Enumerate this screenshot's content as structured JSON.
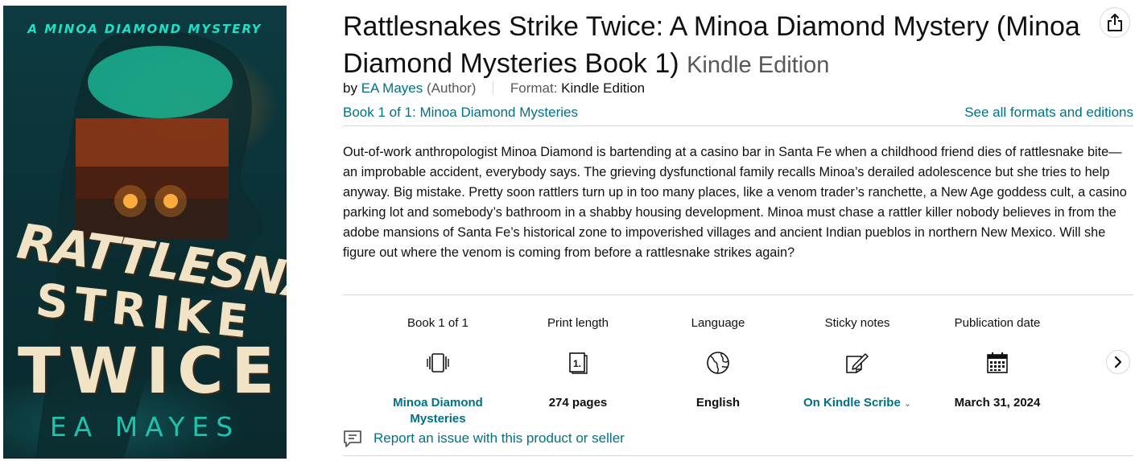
{
  "cover": {
    "series": "A MINOA DIAMOND MYSTERY",
    "title_line1": "RATTLESNAKES",
    "title_line2": "STRIKE",
    "title_line3": "TWICE",
    "author": "EA MAYES"
  },
  "product": {
    "title": "Rattlesnakes Strike Twice: A Minoa Diamond Mystery (Minoa Diamond Mysteries Book 1)",
    "edition": "Kindle Edition",
    "by": "by",
    "author": "EA Mayes",
    "author_role": "(Author)",
    "format_label": "Format:",
    "format_value": "Kindle Edition",
    "series_link": "Book 1 of 1: Minoa Diamond Mysteries",
    "formats_link": "See all formats and editions",
    "description": "Out-of-work anthropologist Minoa Diamond is bartending at a casino bar in Santa Fe when a childhood friend dies of rattlesnake bite—an improbable accident, everybody says. The grieving dysfunctional family recalls Minoa’s derailed adolescence but she tries to help anyway. Big mistake. Pretty soon rattlers turn up in too many places, like a venom trader’s ranchette, a New Age goddess cult, a casino parking lot and somebody’s bathroom in a shabby housing development. Minoa must chase a rattler killer nobody believes in from the adobe mansions of Santa Fe’s historical zone to impoverished villages and ancient Indian pueblos in northern New Mexico. Will she figure out where the venom is coming from before a rattlesnake strikes again?"
  },
  "details": [
    {
      "label": "Book 1 of 1",
      "icon": "book-series-icon",
      "value": "Minoa Diamond Mysteries",
      "link": true
    },
    {
      "label": "Print length",
      "icon": "page-count-icon",
      "value": "274 pages",
      "link": false
    },
    {
      "label": "Language",
      "icon": "globe-icon",
      "value": "English",
      "link": false
    },
    {
      "label": "Sticky notes",
      "icon": "sticky-note-pen-icon",
      "value": "On Kindle Scribe",
      "link": true,
      "dropdown": "⌄"
    },
    {
      "label": "Publication date",
      "icon": "calendar-icon",
      "value": "March 31, 2024",
      "link": false
    }
  ],
  "report": {
    "text": "Report an issue with this product or seller"
  },
  "colors": {
    "link": "#007185",
    "text": "#0f1111",
    "muted": "#565959",
    "rule": "#d5d9d9"
  }
}
